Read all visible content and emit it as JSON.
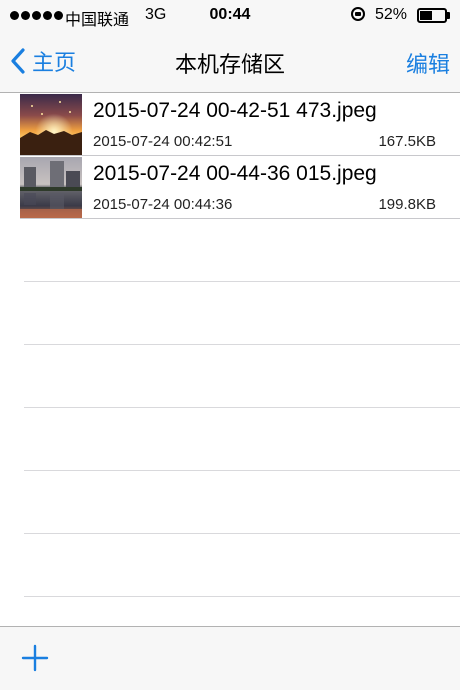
{
  "status_bar": {
    "carrier": "中国联通",
    "network": "3G",
    "time": "00:44",
    "battery_percent": "52%",
    "battery_level": 0.52,
    "icons": [
      "signal-dots",
      "orientation-lock-icon",
      "battery-icon"
    ]
  },
  "nav": {
    "back_label": "主页",
    "title": "本机存储区",
    "edit_label": "编辑",
    "accent_color": "#1a7fe0"
  },
  "files": [
    {
      "name": "2015-07-24 00-42-51 473.jpeg",
      "date": "2015-07-24 00:42:51",
      "size": "167.5KB",
      "thumbnail": "sunset-photo"
    },
    {
      "name": "2015-07-24 00-44-36 015.jpeg",
      "date": "2015-07-24 00:44:36",
      "size": "199.8KB",
      "thumbnail": "lake-buildings-photo"
    }
  ],
  "toolbar": {
    "add_icon": "plus-icon"
  }
}
